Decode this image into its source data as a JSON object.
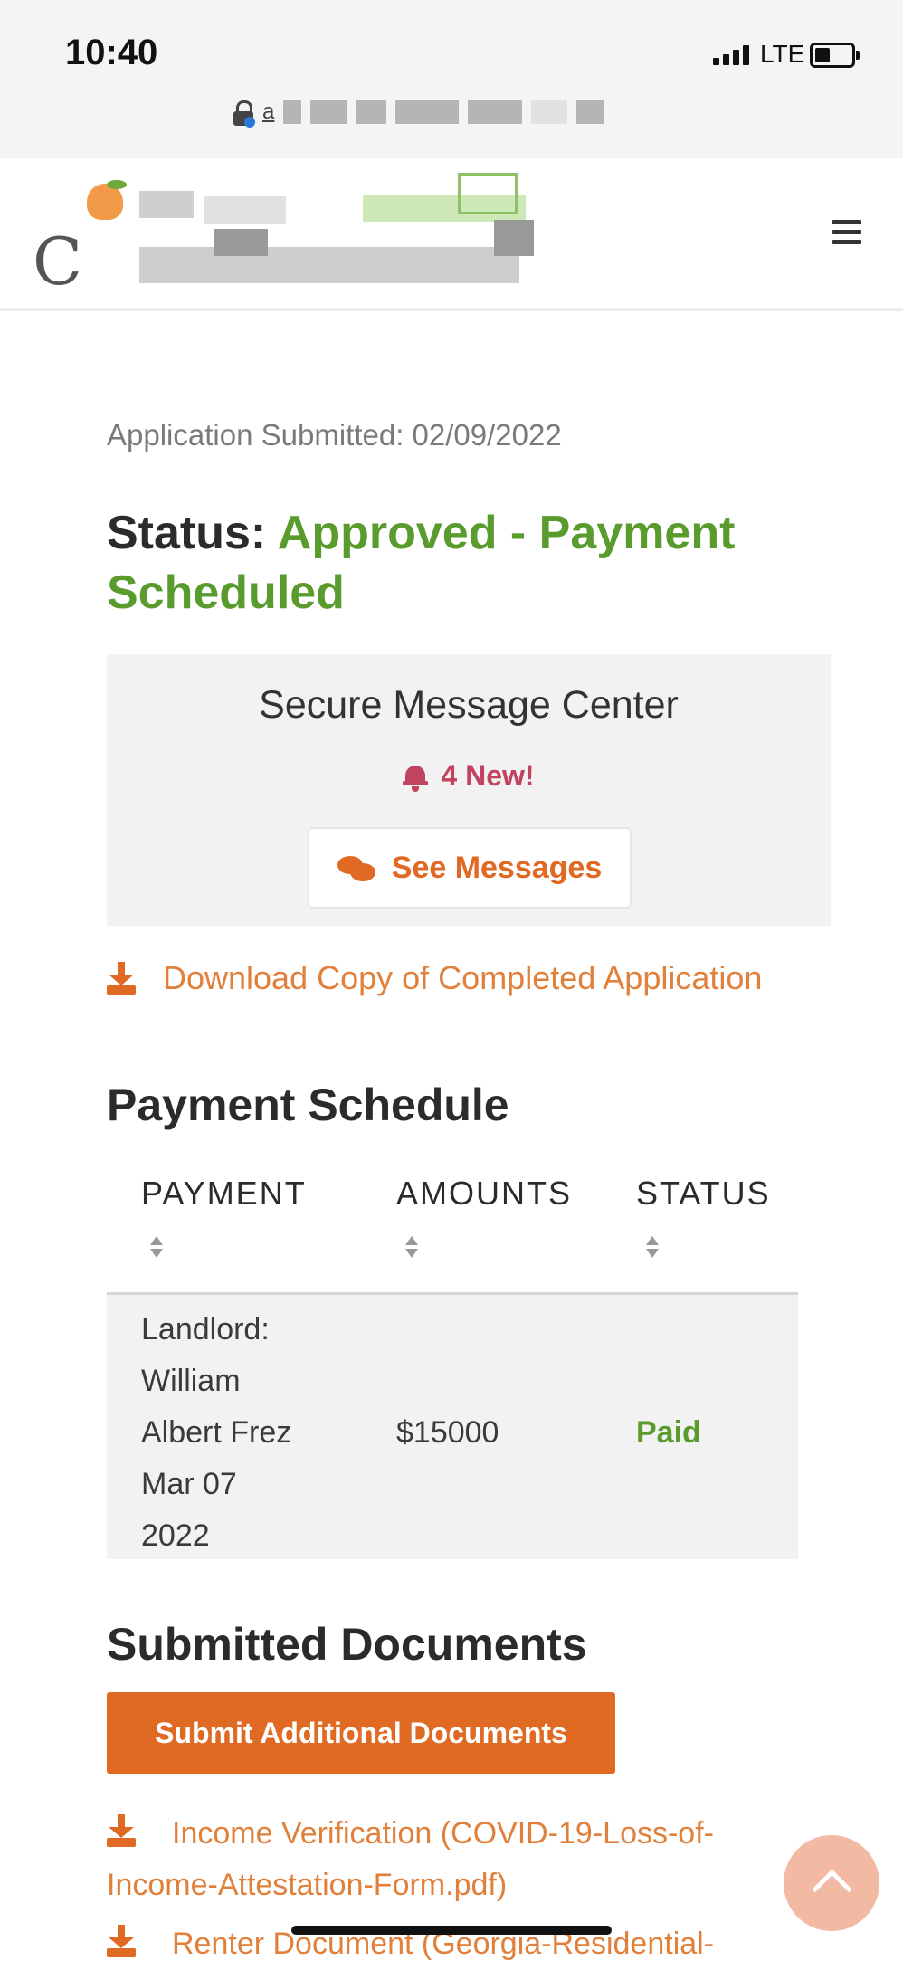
{
  "status_bar": {
    "time": "10:40",
    "network": "LTE"
  },
  "url": {
    "text": "a"
  },
  "header": {
    "logo_letter": "C",
    "menu_icon": "hamburger-menu-icon"
  },
  "application": {
    "submitted_text": "Application Submitted: 02/09/2022",
    "status_label": "Status:",
    "status_value": "Approved - Payment Scheduled"
  },
  "message_center": {
    "title": "Secure Message Center",
    "new_count_text": "4 New!",
    "see_messages_label": "See Messages"
  },
  "download_application_label": "Download Copy of Completed Application",
  "payment_schedule": {
    "title": "Payment Schedule",
    "columns": [
      "PAYMENT",
      "AMOUNTS",
      "STATUS"
    ],
    "rows": [
      {
        "payment_lines": [
          "Landlord:",
          "William",
          "Albert Frez",
          "Mar 07",
          "2022"
        ],
        "amount": "$15000",
        "status": "Paid"
      }
    ]
  },
  "submitted_documents": {
    "title": "Submitted Documents",
    "submit_button_label": "Submit Additional Documents",
    "documents": [
      {
        "label": "Income Verification (COVID-19-Loss-of-Income-Attestation-Form.pdf)"
      },
      {
        "label": "Renter Document (Georgia-Residential-"
      }
    ]
  },
  "colors": {
    "accent_orange": "#e06a23",
    "status_green": "#5a9b2e",
    "alert_pink": "#c2435f"
  }
}
